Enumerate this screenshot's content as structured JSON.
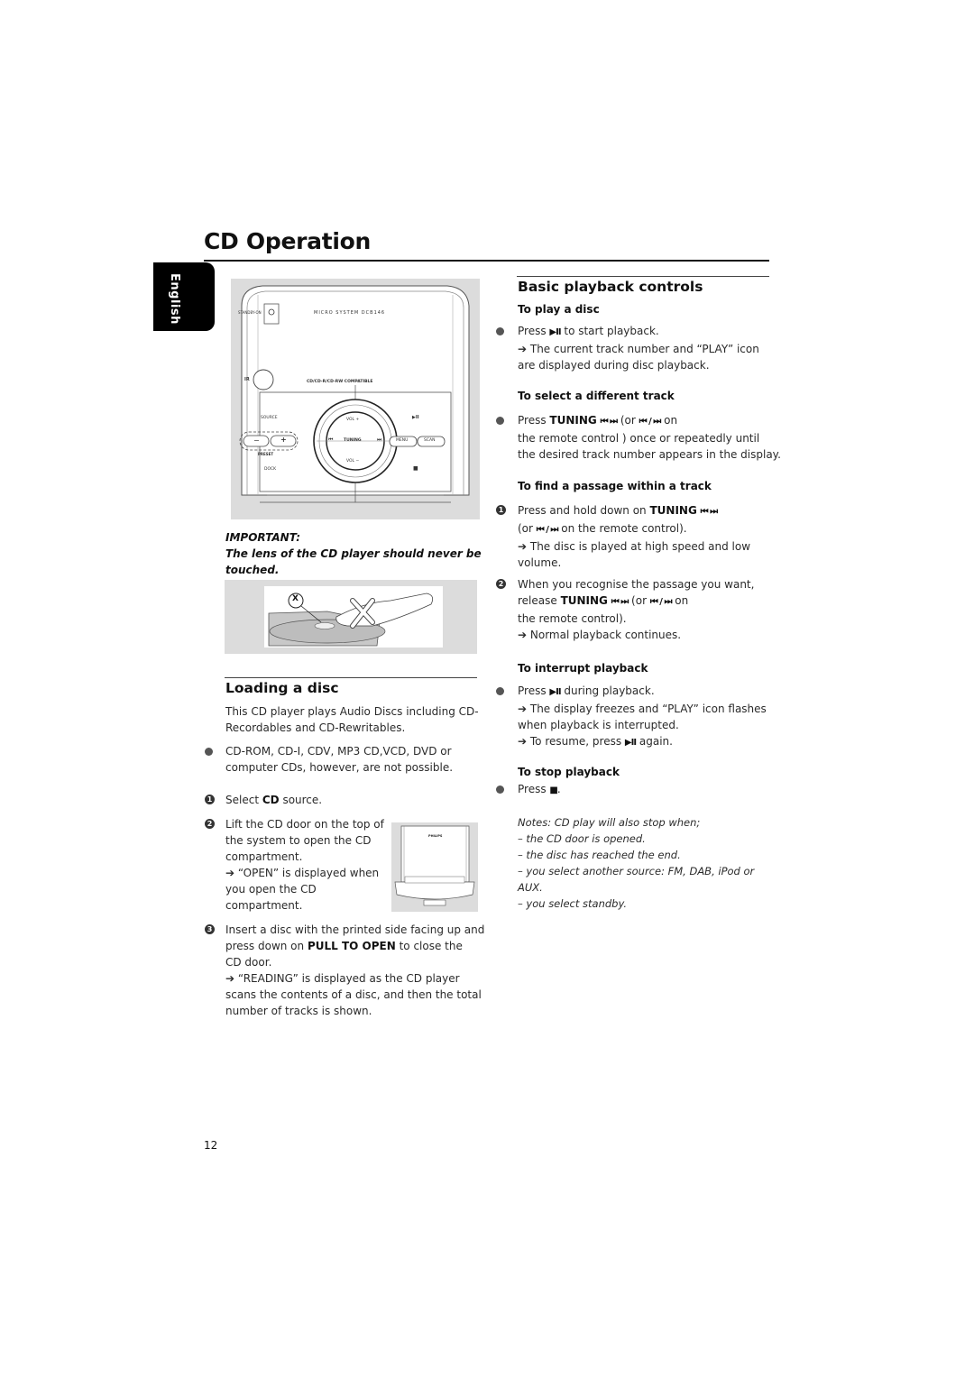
{
  "page": {
    "title": "CD Operation",
    "language_tab": "English",
    "page_number": "12"
  },
  "device_figure": {
    "standby_label": "STANDBY-ON",
    "model_label": "MICRO SYSTEM DCB146",
    "ir_label": "IR",
    "compat_label": "CD/CD-R/CD-RW COMPATIBLE",
    "source_label": "SOURCE",
    "dock_label": "DOCK",
    "preset_label": "PRESET",
    "preset_minus": "−",
    "preset_plus": "+",
    "vol_plus_label": "VOL +",
    "vol_minus_label": "VOL −",
    "tuning_label": "TUNING",
    "prev_symbol": "⏮",
    "next_symbol": "⏭",
    "menu_label": "MENU",
    "scan_label": "SCAN",
    "play_pause_symbol": "▶II",
    "stop_symbol": "■"
  },
  "important": {
    "label": "IMPORTANT:",
    "text_line1": "The lens of the CD player should never be",
    "text_line2": "touched.",
    "marker": "X"
  },
  "loading": {
    "heading": "Loading a disc",
    "intro_line1": "This CD player plays Audio Discs including CD-",
    "intro_line2": "Recordables and CD-Rewritables.",
    "note_line1": "CD-ROM, CD-I, CDV, MP3 CD,VCD, DVD or",
    "note_line2": "computer CDs, however, are not possible.",
    "steps": [
      {
        "num": "1",
        "pre": "Select ",
        "bold": "CD",
        "post": " source."
      },
      {
        "num": "2",
        "lines": [
          "Lift the CD door on the top of",
          "the system to open the CD",
          "compartment.",
          "➔ “OPEN” is displayed when",
          "you open the CD",
          "compartment."
        ]
      },
      {
        "num": "3",
        "line1": "Insert a disc with the printed side facing up and",
        "line2_pre": "press down on ",
        "line2_bold": "PULL TO OPEN",
        "line2_post": " to close the",
        "line3": "CD door.",
        "line4": "➔ “READING” is displayed as the CD player",
        "line5": "scans the contents of a disc, and then the total",
        "line6": "number of tracks is shown."
      }
    ],
    "door_figure_brand": "PHILIPS"
  },
  "playback": {
    "heading": "Basic playback controls",
    "play": {
      "heading": "To play a disc",
      "pre": "Press ",
      "symbol": "▶II",
      "post": " to start playback.",
      "result_line1": "➔ The current track number and “PLAY” icon",
      "result_line2": "are displayed during disc playback."
    },
    "select": {
      "heading": "To select a different track",
      "pre": "Press ",
      "bold": "TUNING",
      "symbols": "⏮ ⏭",
      "mid": " (or ",
      "symbols2": "⏮ / ⏭",
      "post": " on",
      "line2": "the remote control ) once or repeatedly until",
      "line3": "the desired track number appears in the display."
    },
    "find": {
      "heading": "To find a passage within a track",
      "step1_pre": "Press and hold down on ",
      "step1_bold": "TUNING",
      "step1_symbols": "⏮ ⏭",
      "step1_line2_pre": "(or ",
      "step1_line2_symbols": "⏮ / ⏭",
      "step1_line2_post": " on the remote control).",
      "step1_line3": "➔ The disc is played at high speed and low",
      "step1_line4": "volume.",
      "step2_line1": "When you recognise the passage you want,",
      "step2_line2_pre": "release ",
      "step2_line2_bold": "TUNING",
      "step2_line2_symbols": "⏮ ⏭",
      "step2_line2_mid": " (or ",
      "step2_line2_symbols2": "⏮ / ⏭",
      "step2_line2_post": " on",
      "step2_line3": "the remote control).",
      "step2_line4": "➔ Normal playback continues."
    },
    "interrupt": {
      "heading": "To interrupt playback",
      "pre": "Press ",
      "symbol": "▶II",
      "post": " during playback.",
      "line2": "➔ The display freezes and “PLAY” icon flashes",
      "line3": "when playback is interrupted.",
      "line4_pre": "➔ To resume, press ",
      "line4_symbol": "▶II",
      "line4_post": " again."
    },
    "stop": {
      "heading": "To stop playback",
      "pre": "Press ",
      "symbol": "■",
      "post": "."
    },
    "notes": [
      "Notes: CD play will also stop when;",
      "– the CD door is opened.",
      "– the disc has reached the end.",
      "– you select another source:  FM, DAB, iPod or",
      "AUX.",
      "– you select standby."
    ]
  }
}
